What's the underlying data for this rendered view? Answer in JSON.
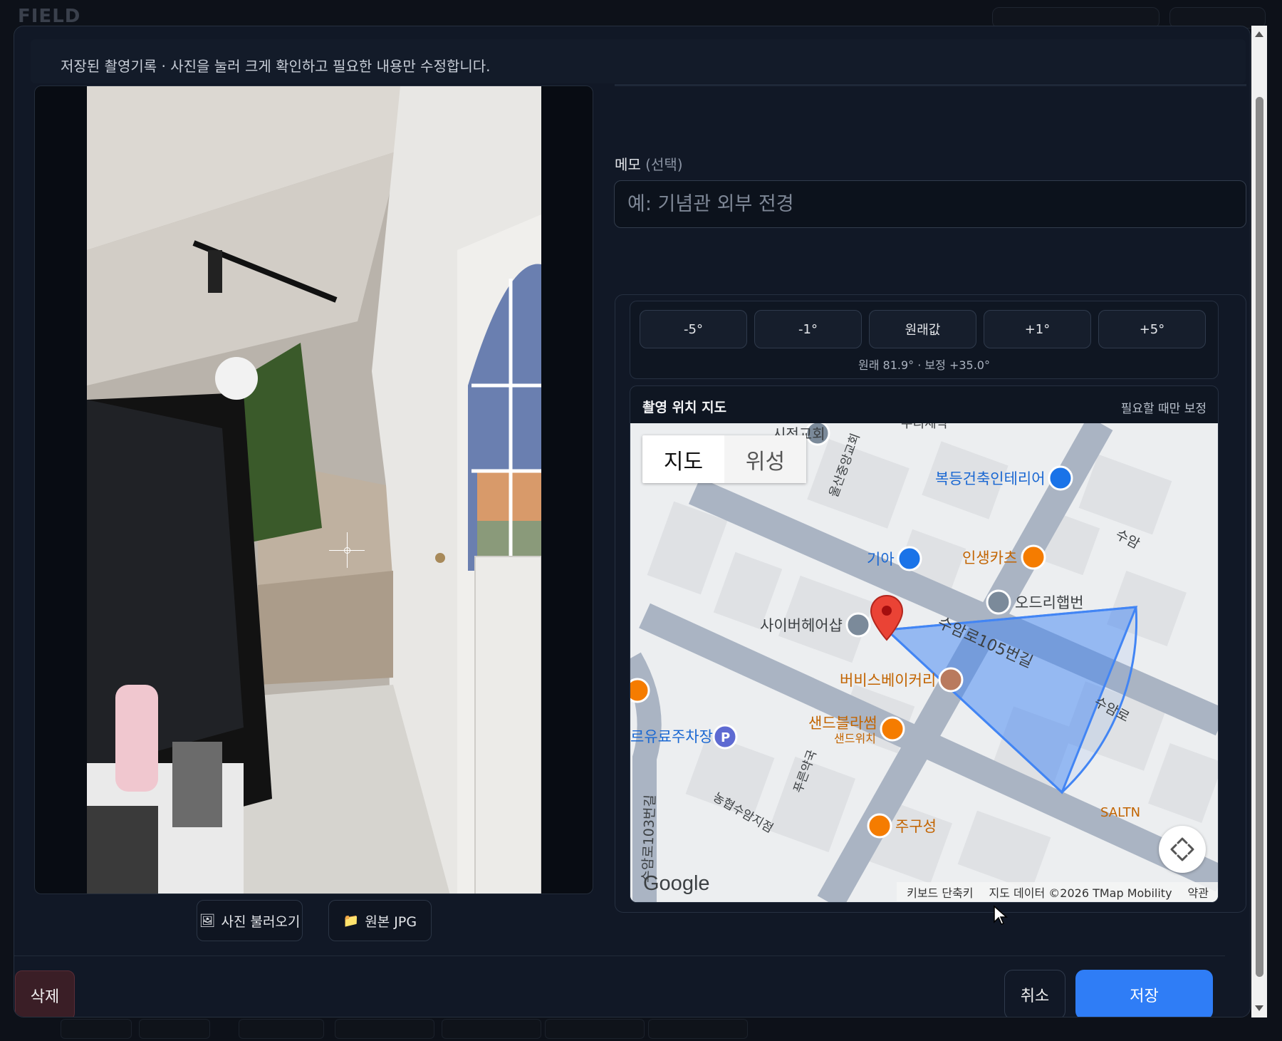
{
  "background": {
    "app_title": "FIELD"
  },
  "modal": {
    "hint": "저장된 촬영기록 · 사진을 눌러 크게 확인하고 필요한 내용만 수정합니다."
  },
  "photo_actions": {
    "load_label": "사진 불러오기",
    "load_icon": "picture-icon",
    "original_label": "원본 JPG",
    "original_icon": "folder-icon"
  },
  "memo": {
    "label": "메모",
    "optional": "(선택)",
    "placeholder": "예: 기념관 외부 전경",
    "value": ""
  },
  "heading_adjust": {
    "buttons": [
      "-5°",
      "-1°",
      "원래값",
      "+1°",
      "+5°"
    ],
    "note": "원래 81.9° · 보정 +35.0°"
  },
  "map": {
    "title": "촬영 위치 지도",
    "subtitle": "필요할 때만 보정",
    "tab_map": "지도",
    "tab_satellite": "위성",
    "logo": "Google",
    "attribution": {
      "shortcuts": "키보드 단축키",
      "data": "지도 데이터 ©2026 TMap Mobility",
      "terms": "약관"
    },
    "labels": {
      "church": "시전교회",
      "road_vertical": "울산중앙교회",
      "interior": "복등건축인테리어",
      "kia": "기아",
      "cars": "인생카츠",
      "audi": "오드리햅번",
      "hair": "사이버헤어샵",
      "road_main": "수암로105번길",
      "bakery": "버비스베이커리",
      "sandwich1": "샌드블라썸",
      "sandwich2": "샌드위치",
      "parking": "르유료주차장",
      "pharmacy": "푸른약국",
      "bank": "농협수암지점",
      "road_left": "수암로103번길",
      "road_right": "수암로",
      "road_right2": "수암",
      "bottom_place": "주구성",
      "bottom_right": "SALTN",
      "top_place": "우리세탁"
    },
    "accent_color": "#4285f4",
    "marker_color": "#ea4335"
  },
  "footer": {
    "delete_label": "삭제",
    "cancel_label": "취소",
    "save_label": "저장",
    "save_color": "#2f7df6"
  }
}
